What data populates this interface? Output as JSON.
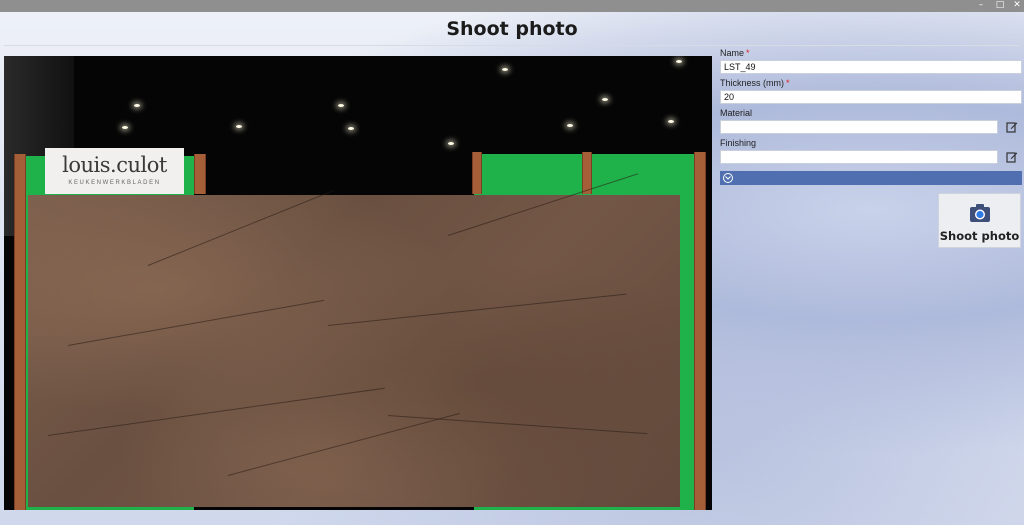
{
  "window": {
    "controls": [
      "–",
      "□",
      "✕"
    ]
  },
  "header": {
    "title": "Shoot photo"
  },
  "photo": {
    "logo_text": "louis.culot",
    "logo_subtext": "KEUKENWERKBLADEN"
  },
  "form": {
    "name": {
      "label": "Name",
      "required_mark": "*",
      "value": "LST_49"
    },
    "thickness": {
      "label": "Thickness (mm)",
      "required_mark": "*",
      "value": "20"
    },
    "material": {
      "label": "Material",
      "value": "",
      "edit_icon": "edit-icon"
    },
    "finishing": {
      "label": "Finishing",
      "value": "",
      "edit_icon": "edit-icon"
    }
  },
  "expander": {
    "icon": "chevron-down-icon"
  },
  "shoot_button": {
    "label": "Shoot photo",
    "icon": "camera-icon"
  },
  "colors": {
    "accent": "#4f6fb0",
    "required": "#dd2222",
    "green_screen": "#1fb24a"
  }
}
